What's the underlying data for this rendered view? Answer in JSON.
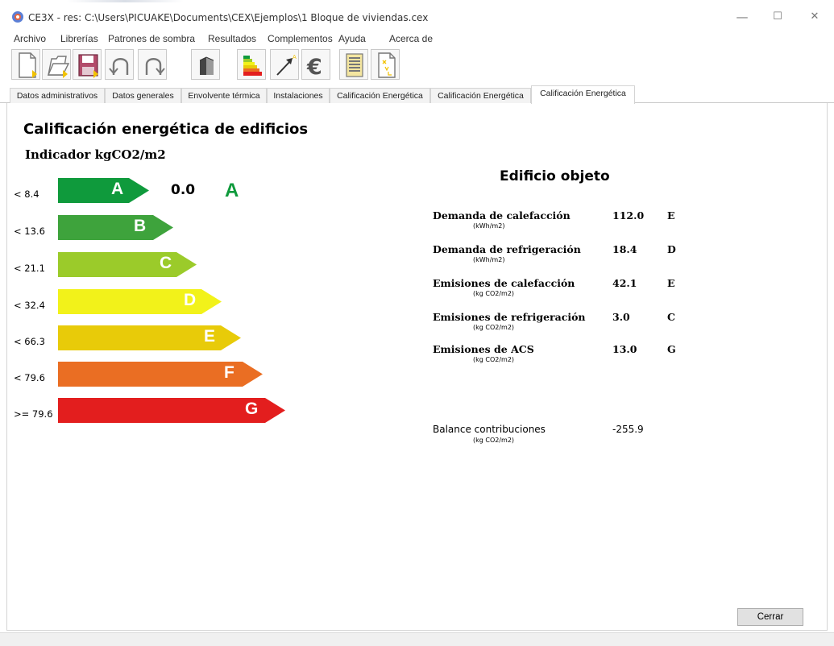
{
  "window": {
    "title": "CE3X - res: C:\\Users\\PICUAKE\\Documents\\CEX\\Ejemplos\\1 Bloque de viviendas.cex",
    "minimize": "—",
    "maximize": "☐",
    "close": "✕"
  },
  "menu": [
    "Archivo",
    "Librerías",
    "Patrones de sombra",
    "Resultados",
    "Complementos",
    "Ayuda",
    "Acerca de"
  ],
  "toolbar": {
    "buttons": [
      "new-document-icon",
      "open-folder-icon",
      "save-icon",
      "undo-icon",
      "redo-icon",
      "building-icon",
      "energy-scale-icon",
      "improvement-arrow-icon",
      "euro-icon",
      "report-icon",
      "xml-icon"
    ]
  },
  "tabs": [
    "Datos administrativos",
    "Datos generales",
    "Envolvente térmica",
    "Instalaciones",
    "Calificación Energética",
    "Calificación Energética",
    "Calificación Energética"
  ],
  "content": {
    "title": "Calificación energética de edificios",
    "indicator": "Indicador kgCO2/m2",
    "scale": [
      {
        "label": "< 8.4",
        "letter": "A",
        "color": "#0f9a3c"
      },
      {
        "label": "< 13.6",
        "letter": "B",
        "color": "#3ea33c"
      },
      {
        "label": "< 21.1",
        "letter": "C",
        "color": "#9bcb2a"
      },
      {
        "label": "< 32.4",
        "letter": "D",
        "color": "#f2f21a"
      },
      {
        "label": "< 66.3",
        "letter": "E",
        "color": "#e8cb09"
      },
      {
        "label": "< 79.6",
        "letter": "F",
        "color": "#ea6e23"
      },
      {
        "label": ">= 79.6",
        "letter": "G",
        "color": "#e31e1e"
      }
    ],
    "result": {
      "value": "0.0",
      "letter": "A"
    },
    "object_title": "Edificio objeto",
    "indicators": [
      {
        "label": "Demanda de calefacción",
        "unit": "(kWh/m2)",
        "value": "112.0",
        "letter": "E"
      },
      {
        "label": "Demanda de refrigeración",
        "unit": "(kWh/m2)",
        "value": "18.4",
        "letter": "D"
      },
      {
        "label": "Emisiones de calefacción",
        "unit": "(kg CO2/m2)",
        "value": "42.1",
        "letter": "E"
      },
      {
        "label": "Emisiones de refrigeración",
        "unit": "(kg CO2/m2)",
        "value": "3.0",
        "letter": "C"
      },
      {
        "label": "Emisiones de ACS",
        "unit": "(kg CO2/m2)",
        "value": "13.0",
        "letter": "G"
      }
    ],
    "balance": {
      "label": "Balance contribuciones",
      "unit": "(kg CO2/m2)",
      "value": "-255.9"
    }
  },
  "close_button": "Cerrar"
}
